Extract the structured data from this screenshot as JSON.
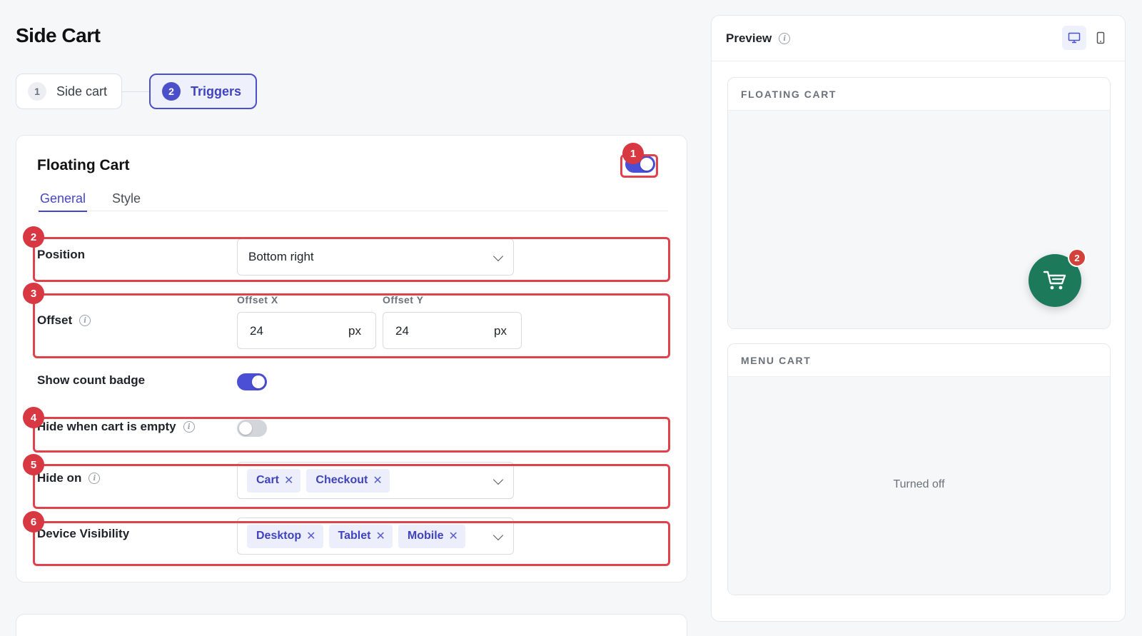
{
  "page": {
    "title": "Side Cart"
  },
  "stepper": {
    "steps": [
      {
        "number": "1",
        "label": "Side cart",
        "active": false
      },
      {
        "number": "2",
        "label": "Triggers",
        "active": true
      }
    ]
  },
  "floating_cart": {
    "title": "Floating Cart",
    "enabled": true,
    "tabs": [
      {
        "label": "General",
        "active": true
      },
      {
        "label": "Style",
        "active": false
      }
    ],
    "position": {
      "label": "Position",
      "value": "Bottom right"
    },
    "offset": {
      "label": "Offset",
      "x": {
        "label": "Offset X",
        "value": "24",
        "unit": "px"
      },
      "y": {
        "label": "Offset Y",
        "value": "24",
        "unit": "px"
      }
    },
    "show_count_badge": {
      "label": "Show count badge",
      "enabled": true
    },
    "hide_when_empty": {
      "label": "Hide when cart is empty",
      "enabled": false
    },
    "hide_on": {
      "label": "Hide on",
      "chips": [
        "Cart",
        "Checkout"
      ]
    },
    "device_visibility": {
      "label": "Device Visibility",
      "chips": [
        "Desktop",
        "Tablet",
        "Mobile"
      ]
    }
  },
  "annotations": [
    "1",
    "2",
    "3",
    "4",
    "5",
    "6"
  ],
  "preview": {
    "title": "Preview",
    "devices": [
      {
        "icon": "desktop-icon",
        "active": true
      },
      {
        "icon": "mobile-icon",
        "active": false
      }
    ],
    "floating_cart": {
      "heading": "FLOATING CART",
      "count": "2"
    },
    "menu_cart": {
      "heading": "MENU CART",
      "status": "Turned off"
    }
  },
  "colors": {
    "accent": "#4b4fd6",
    "highlight": "#e0424b",
    "cart_button": "#1c7a5b",
    "count_badge": "#d3423a"
  }
}
